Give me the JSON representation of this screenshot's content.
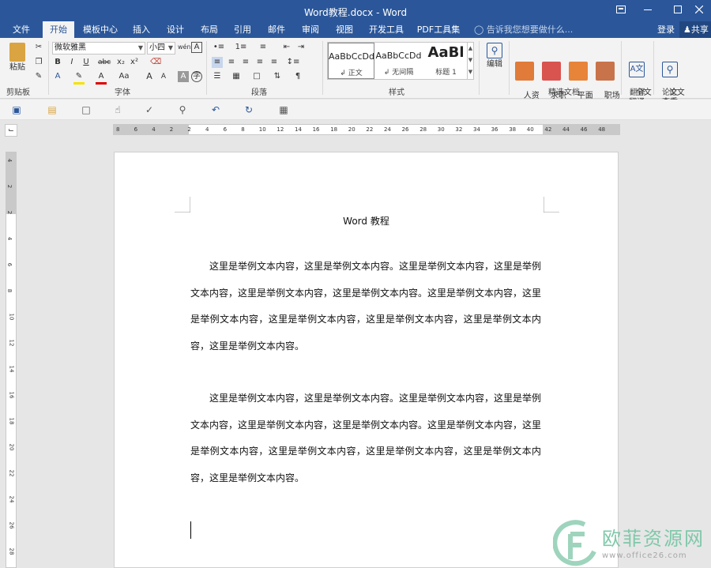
{
  "window": {
    "title": "Word教程.docx - Word"
  },
  "tabs": [
    {
      "label": "文件",
      "active": false
    },
    {
      "label": "开始",
      "active": true
    },
    {
      "label": "模板中心",
      "active": false
    },
    {
      "label": "插入",
      "active": false
    },
    {
      "label": "设计",
      "active": false
    },
    {
      "label": "布局",
      "active": false
    },
    {
      "label": "引用",
      "active": false
    },
    {
      "label": "邮件",
      "active": false
    },
    {
      "label": "审阅",
      "active": false
    },
    {
      "label": "视图",
      "active": false
    },
    {
      "label": "开发工具",
      "active": false
    },
    {
      "label": "PDF工具集",
      "active": false
    }
  ],
  "tellme": "告诉我您想要做什么...",
  "account": {
    "login": "登录",
    "share": "共享"
  },
  "ribbon": {
    "clipboard": {
      "paste": "粘贴",
      "label": "剪贴板"
    },
    "font": {
      "name": "微软雅黑",
      "size": "小四",
      "label": "字体",
      "bold": "B",
      "italic": "I",
      "underline": "U",
      "strike": "abc",
      "sub": "x₂",
      "sup": "x²",
      "fontcolor": "A",
      "case": "Aa",
      "grow": "A",
      "shrink": "A"
    },
    "paragraph": {
      "label": "段落"
    },
    "styles": {
      "label": "样式",
      "items": [
        {
          "preview": "AaBbCcDd",
          "name": "↲ 正文"
        },
        {
          "preview": "AaBbCcDd",
          "name": "↲ 无间隔"
        },
        {
          "preview": "AaBl",
          "name": "标题 1"
        }
      ]
    },
    "editing": {
      "label": "编辑"
    },
    "jingxuan": {
      "label": "精选文档",
      "items": [
        "人资\n行政",
        "求职\n简历",
        "平面\n设计",
        "职场\n办公"
      ]
    },
    "translate": {
      "label": "翻译",
      "item": "全文\n翻译"
    },
    "paper": {
      "label": "论文",
      "item": "论文\n查重"
    }
  },
  "ruler": {
    "h_ticks": [
      "8",
      "6",
      "4",
      "2",
      "2",
      "4",
      "6",
      "8",
      "10",
      "12",
      "14",
      "16",
      "18",
      "20",
      "22",
      "24",
      "26",
      "28",
      "30",
      "32",
      "34",
      "36",
      "38",
      "40",
      "42",
      "44",
      "46",
      "48"
    ],
    "v_ticks": [
      "4",
      "2",
      "2",
      "4",
      "6",
      "8",
      "10",
      "12",
      "14",
      "16",
      "18",
      "20",
      "22",
      "24",
      "26",
      "28"
    ]
  },
  "document": {
    "title": "Word 教程",
    "paragraphs": [
      "这里是举例文本内容，这里是举例文本内容。这里是举例文本内容，这里是举例文本内容，这里是举例文本内容，这里是举例文本内容。这里是举例文本内容，这里是举例文本内容，这里是举例文本内容，这里是举例文本内容，这里是举例文本内容，这里是举例文本内容。",
      "这里是举例文本内容，这里是举例文本内容。这里是举例文本内容，这里是举例文本内容，这里是举例文本内容，这里是举例文本内容。这里是举例文本内容，这里是举例文本内容，这里是举例文本内容，这里是举例文本内容，这里是举例文本内容，这里是举例文本内容。"
    ]
  },
  "watermark": {
    "text": "欧菲资源网",
    "url": "www.office26.com"
  },
  "colors": {
    "accent": "#2b579a",
    "ribbon": "#f3f3f3",
    "watermark": "#7fc8a9"
  }
}
